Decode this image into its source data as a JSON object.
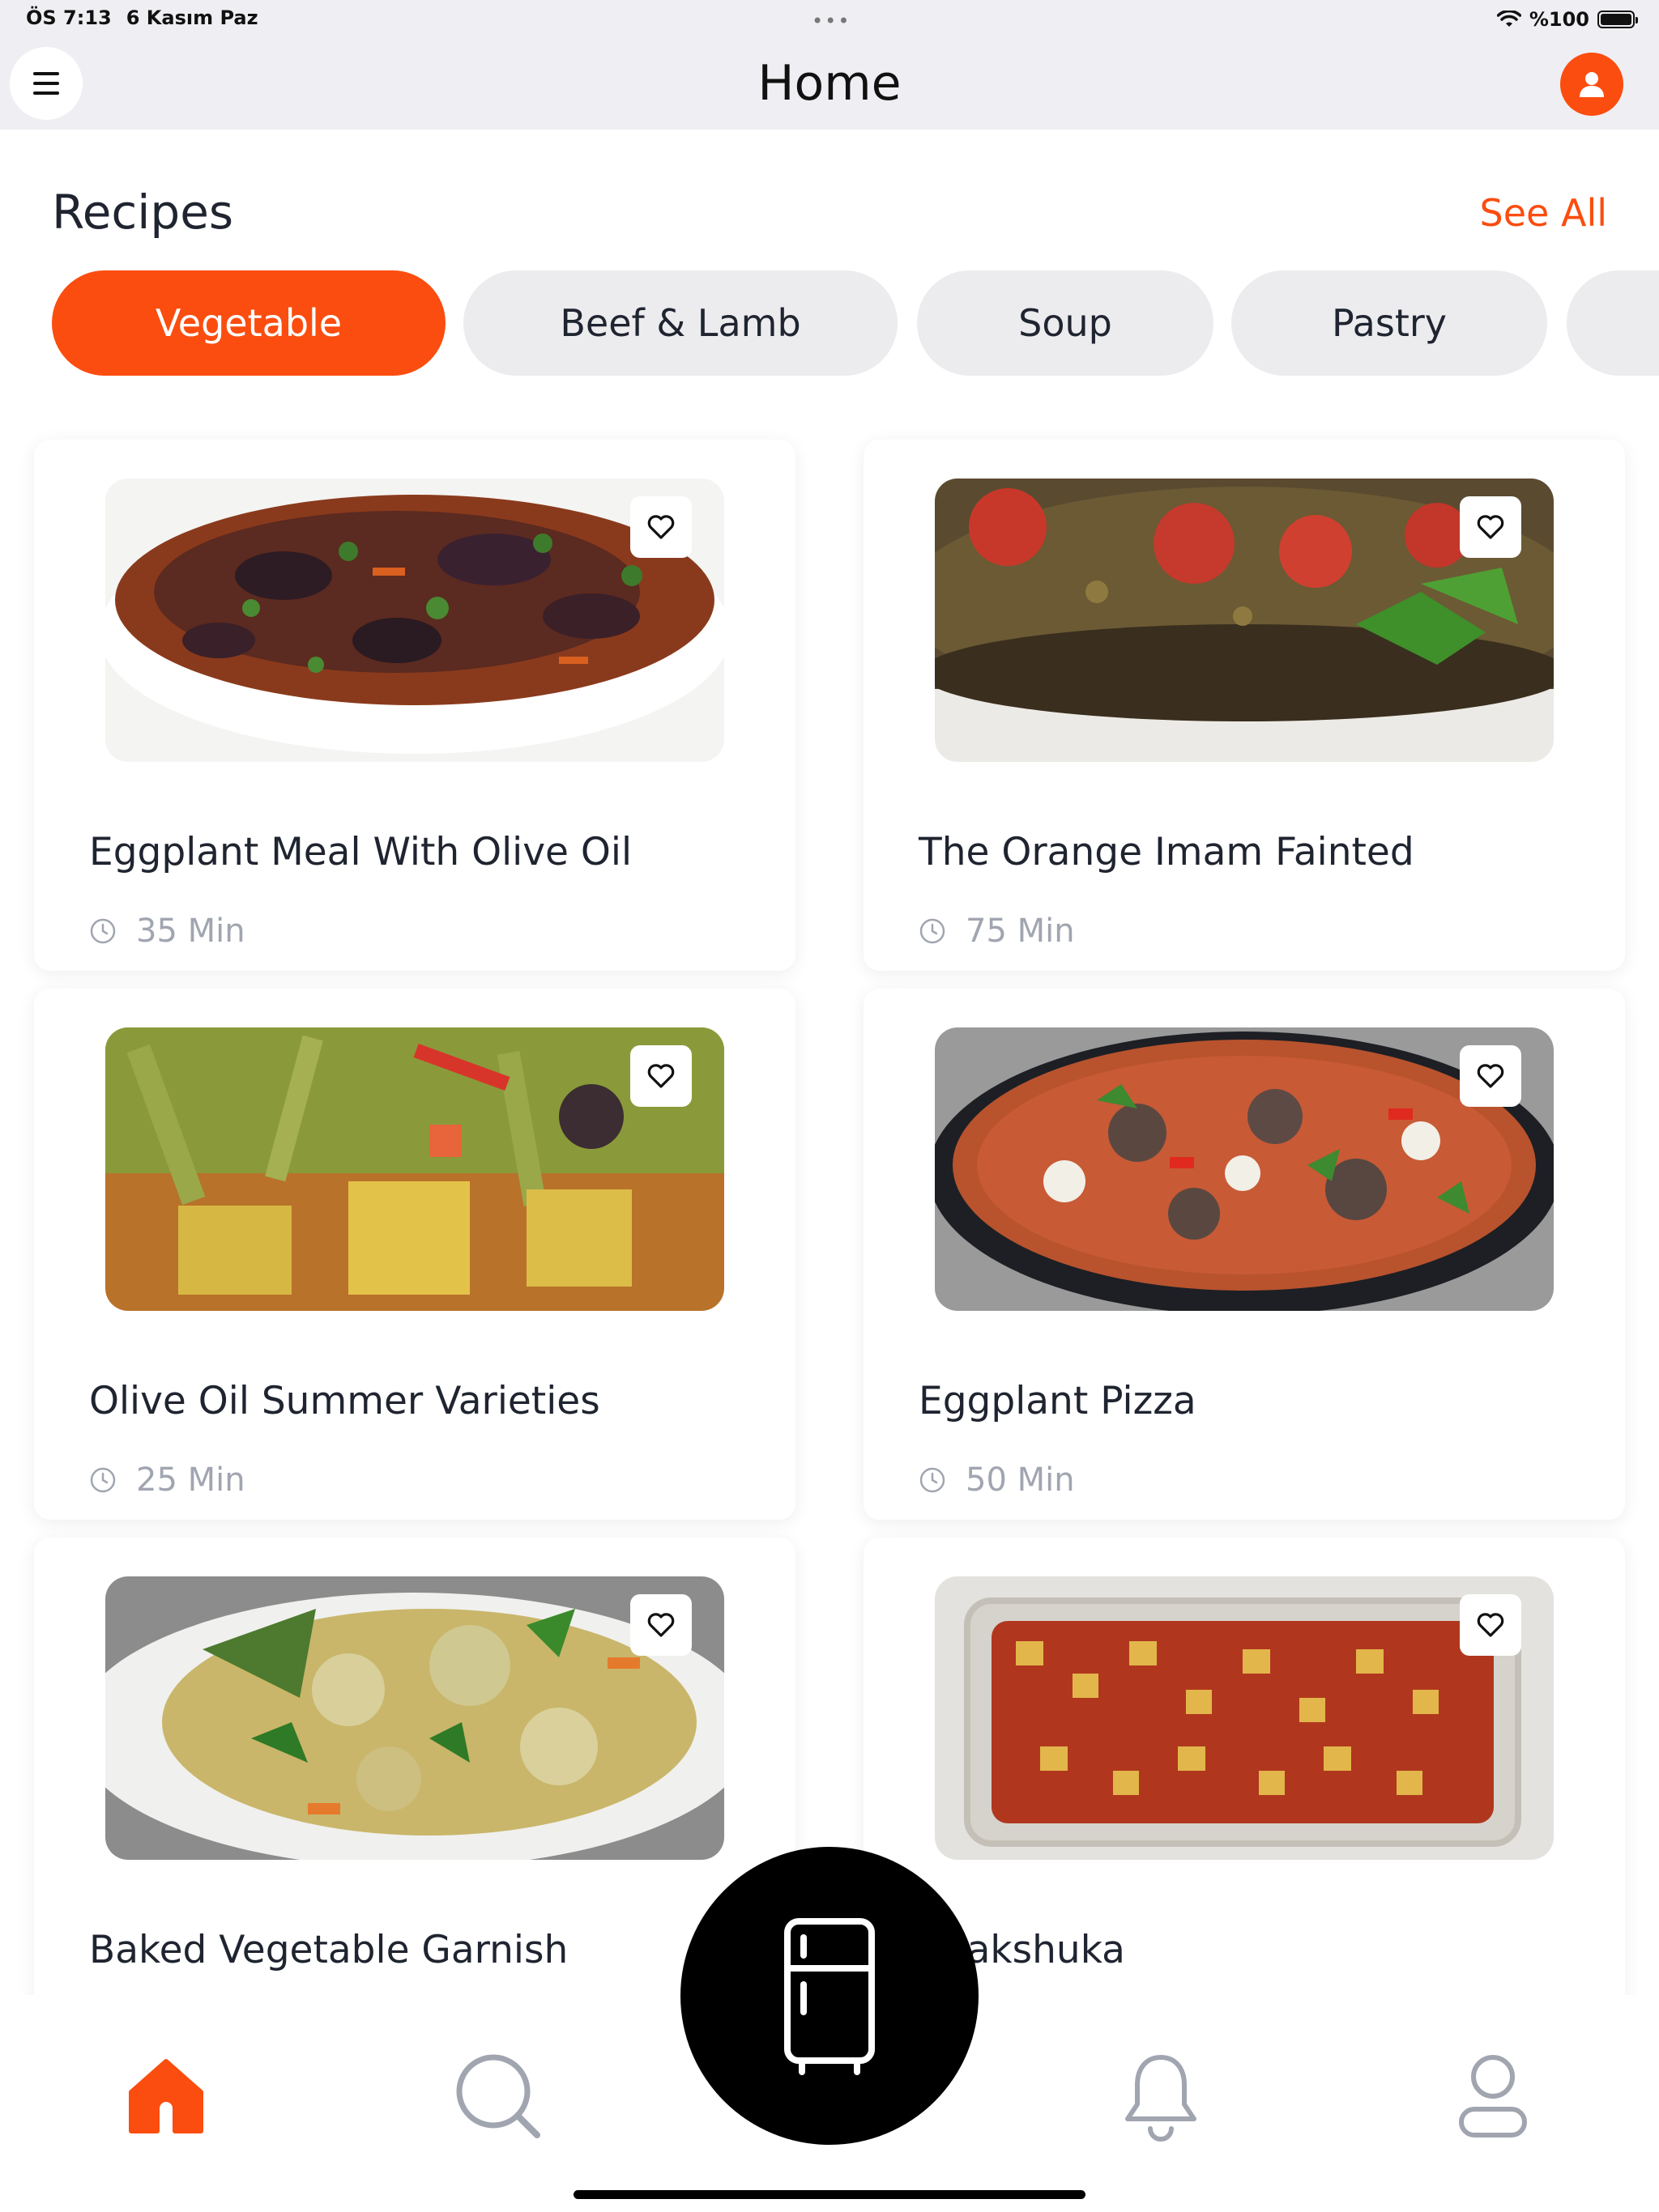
{
  "status_bar": {
    "time": "ÖS 7:13",
    "date": "6 Kasım Paz",
    "dots": "•••",
    "battery": "%100"
  },
  "header": {
    "title": "Home",
    "menu_icon": "hamburger-icon",
    "profile_icon": "user-icon"
  },
  "recipes": {
    "title": "Recipes",
    "see_all": "See All"
  },
  "categories": [
    {
      "label": "Vegetable",
      "active": true
    },
    {
      "label": "Beef & Lamb",
      "active": false
    },
    {
      "label": "Soup",
      "active": false
    },
    {
      "label": "Pastry",
      "active": false
    },
    {
      "label": "",
      "active": false
    }
  ],
  "cards": [
    {
      "title": "Eggplant Meal With Olive Oil",
      "time": "35 Min"
    },
    {
      "title": "The Orange Imam Fainted",
      "time": "75 Min"
    },
    {
      "title": "Olive Oil Summer Varieties",
      "time": "25 Min"
    },
    {
      "title": "Eggplant Pizza",
      "time": "50 Min"
    },
    {
      "title": "Baked Vegetable Garnish",
      "time": ""
    },
    {
      "title": "Shakshuka",
      "time": ""
    }
  ],
  "bottom_nav": {
    "items": [
      "home-icon",
      "search-icon",
      "fridge-icon",
      "bell-icon",
      "profile-icon"
    ]
  },
  "colors": {
    "accent": "#fb4d0f",
    "chip_bg": "#ececef",
    "header_bg": "#efeff3",
    "muted_text": "#a0a5b0"
  }
}
